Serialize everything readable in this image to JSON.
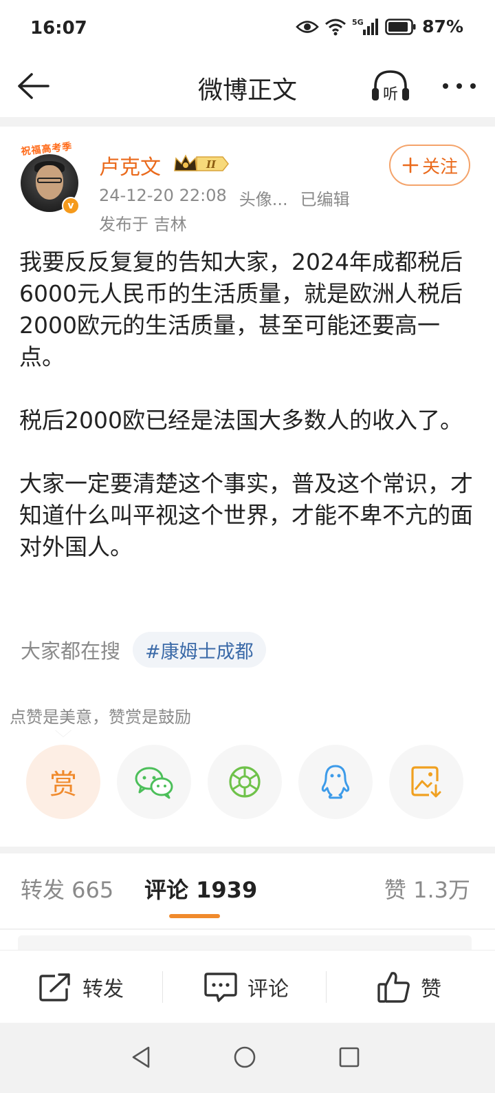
{
  "status_bar": {
    "time": "16:07",
    "network": "5G",
    "battery": "87%"
  },
  "header": {
    "title": "微博正文",
    "listen_label": "听",
    "icons": [
      "back-arrow-icon",
      "headphones-icon",
      "more-icon"
    ]
  },
  "post": {
    "avatar_banner": "祝福高考季",
    "author": "卢克文",
    "vip_level": "II",
    "timestamp": "24-12-20 22:08",
    "source": "头像...",
    "edited": "已编辑",
    "location": "发布于 吉林",
    "follow_label": "关注",
    "paragraphs": [
      "我要反反复复的告知大家，2024年成都税后6000元人民币的生活质量，就是欧洲人税后2000欧元的生活质量，甚至可能还要高一点。",
      "税后2000欧已经是法国大多数人的收入了。",
      "大家一定要清楚这个事实，普及这个常识，才知道什么叫平视这个世界，才能不卑不亢的面对外国人。"
    ],
    "search_label": "大家都在搜",
    "search_tag": "#康姆士成都",
    "reward_tip": "点赞是美意，赞赏是鼓励",
    "reward_label": "赏",
    "share_targets": [
      "reward",
      "wechat",
      "moments",
      "qq",
      "save-image"
    ],
    "colors": {
      "accent": "#ea6a1c",
      "link": "#3b6aa8",
      "wechat": "#4cbf5a",
      "qq": "#3d9be9",
      "save": "#f0a020"
    }
  },
  "tabs": {
    "repost": "转发 665",
    "comment": "评论 1939",
    "like": "赞 1.3万"
  },
  "actions": {
    "repost": "转发",
    "comment": "评论",
    "like": "赞"
  },
  "nav": [
    "back-triangle-icon",
    "home-circle-icon",
    "recents-square-icon"
  ]
}
